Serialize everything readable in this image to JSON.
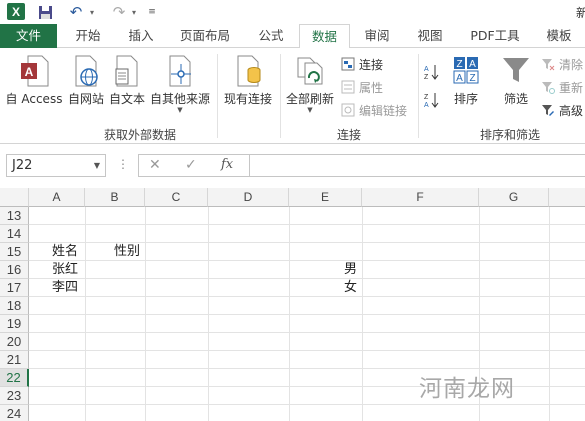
{
  "titlebar": {
    "app_icon": "X",
    "window_title": "新"
  },
  "tabs": [
    {
      "label": "文件"
    },
    {
      "label": "开始"
    },
    {
      "label": "插入"
    },
    {
      "label": "页面布局"
    },
    {
      "label": "公式"
    },
    {
      "label": "数据"
    },
    {
      "label": "审阅"
    },
    {
      "label": "视图"
    },
    {
      "label": "PDF工具"
    },
    {
      "label": "模板"
    }
  ],
  "active_tab": "数据",
  "ribbon": {
    "get_external": {
      "label": "获取外部数据",
      "buttons": [
        {
          "label": "自 Access",
          "icon": "access-icon"
        },
        {
          "label": "自网站",
          "icon": "web-icon"
        },
        {
          "label": "自文本",
          "icon": "text-file-icon"
        },
        {
          "label": "自其他来源",
          "icon": "other-sources-icon"
        },
        {
          "label": "现有连接",
          "icon": "existing-connections-icon"
        }
      ]
    },
    "connections": {
      "label": "连接",
      "refresh_all": "全部刷新",
      "small": [
        {
          "label": "连接",
          "disabled": false
        },
        {
          "label": "属性",
          "disabled": true
        },
        {
          "label": "编辑链接",
          "disabled": true
        }
      ]
    },
    "sort_filter": {
      "label": "排序和筛选",
      "sort": "排序",
      "filter": "筛选",
      "small": [
        {
          "label": "清除",
          "disabled": true
        },
        {
          "label": "重新",
          "disabled": true
        },
        {
          "label": "高级",
          "disabled": false
        }
      ]
    }
  },
  "formula_bar": {
    "name_box": "J22",
    "fx": "fx",
    "formula": ""
  },
  "columns": [
    "A",
    "B",
    "C",
    "D",
    "E",
    "F",
    "G"
  ],
  "rows": [
    "13",
    "14",
    "15",
    "16",
    "17",
    "18",
    "19",
    "20",
    "21",
    "22",
    "23",
    "24"
  ],
  "selected_row": "22",
  "cells": {
    "a15": "姓名",
    "b15": "性别",
    "a16": "张红",
    "e16": "男",
    "a17": "李四",
    "e17": "女"
  },
  "watermark": "河南龙网",
  "colors": {
    "excel_green": "#217346",
    "access_red": "#a4373a"
  }
}
